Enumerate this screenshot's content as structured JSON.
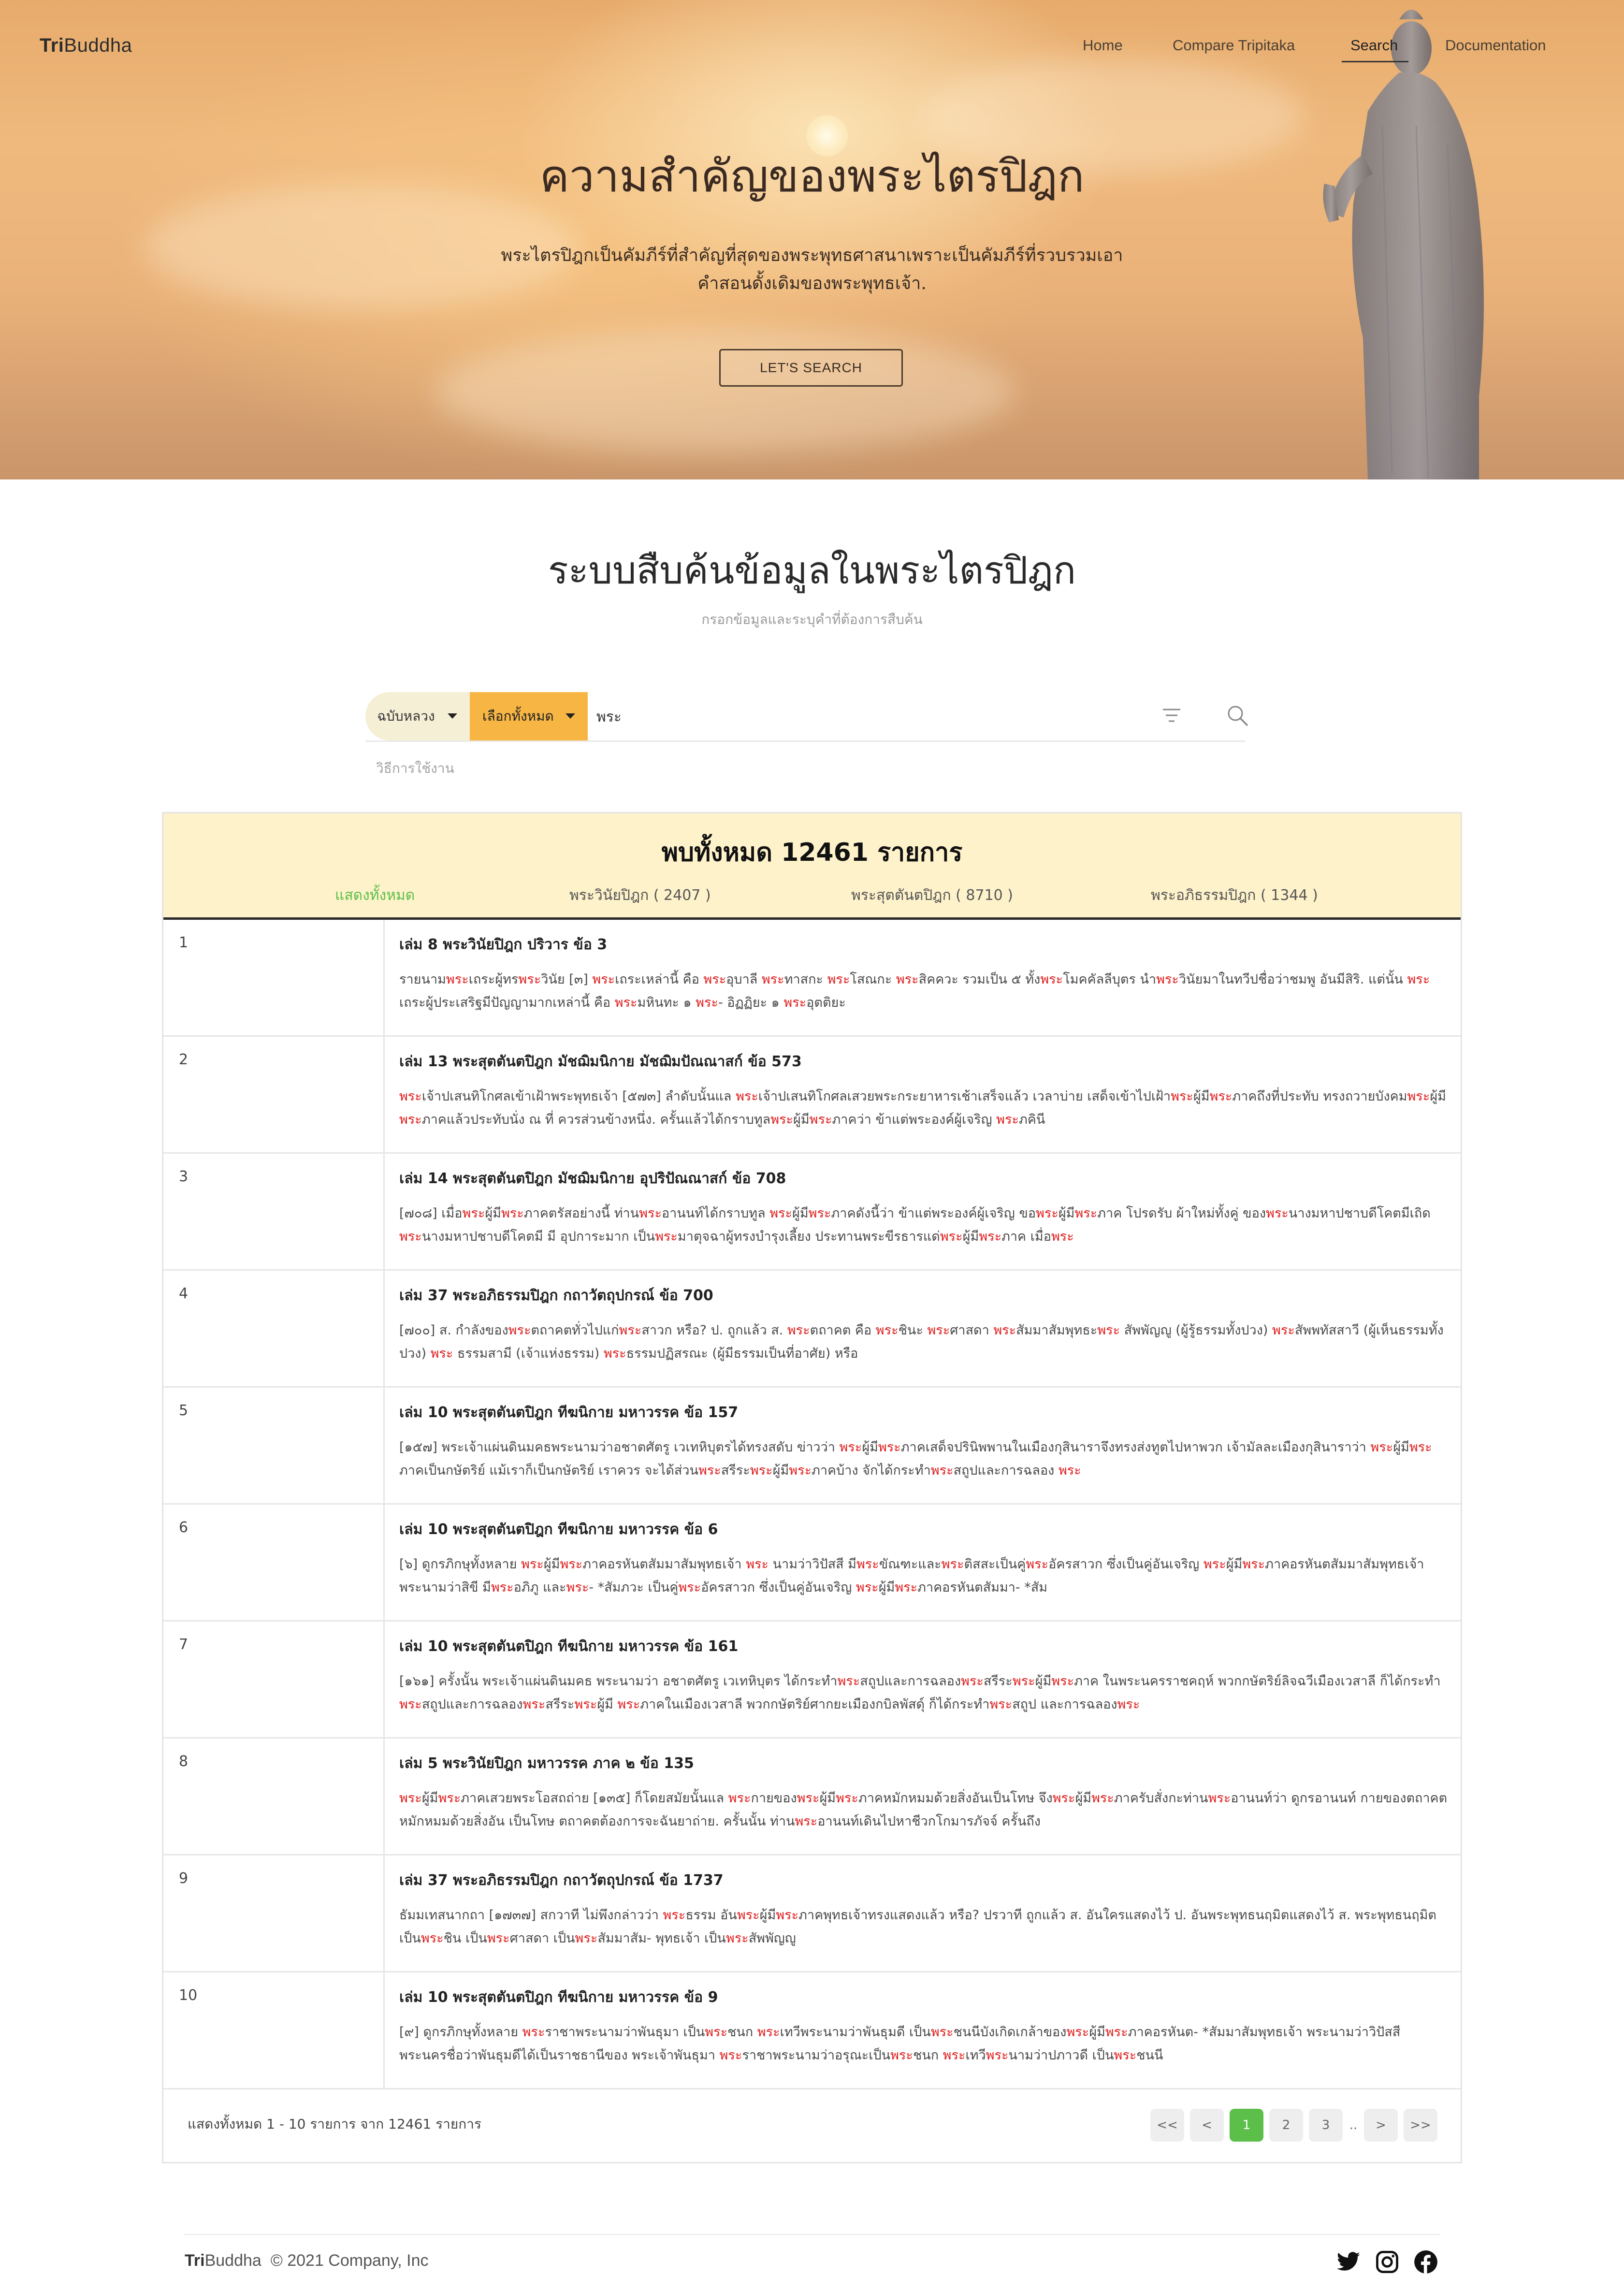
{
  "brand": {
    "bold": "Tri",
    "rest": "Buddha"
  },
  "nav": {
    "home": "Home",
    "compare": "Compare Tripitaka",
    "search": "Search",
    "documentation": "Documentation"
  },
  "hero": {
    "title": "ความสำคัญของพระไตรปิฎก",
    "description": "พระไตรปิฎกเป็นคัมภีร์ที่สำคัญที่สุดของพระพุทธศาสนาเพราะเป็นคัมภีร์ที่รวบรวมเอาคำสอนดั้งเดิมของพระพุทธเจ้า.",
    "button": "LET'S SEARCH"
  },
  "search": {
    "title": "ระบบสืบค้นข้อมูลในพระไตรปิฎก",
    "subtitle": "กรอกข้อมูลและระบุคำที่ต้องการสืบค้น",
    "edition_selected": "ฉบับหลวง",
    "book_selected": "เลือกทั้งหมด",
    "query_value": "พระ",
    "howto": "วิธีการใช้งาน"
  },
  "results": {
    "header": "พบทั้งหมด 12461 รายการ",
    "tabs": {
      "all": "แสดงทั้งหมด",
      "vinaya": "พระวินัยปิฎก ( 2407 )",
      "sutta": "พระสุตตันตปิฎก ( 8710 )",
      "abhidhamma": "พระอภิธรรมปิฎก ( 1344 )"
    },
    "highlight_color": "#e11d1d",
    "items": [
      {
        "num": "1",
        "title": "เล่ม 8 พระวินัยปิฎก ปริวาร ข้อ 3",
        "snippet": "รายนาม[[พระ]]เถระผู้ทร[[พระ]]วินัย [๓] [[พระ]]เถระเหล่านี้ คือ [[พระ]]อุบาลี [[พระ]]ทาสกะ [[พระ]]โสณกะ [[พระ]]สิคควะ รวมเป็น ๕ ทั้ง[[พระ]]โมคคัลลีบุตร นำ[[พระ]]วินัยมาในทวีปชื่อว่าชมพู อันมีสิริ. แต่นั้น [[พระ]]เถระผู้ประเสริฐมีปัญญามากเหล่านี้ คือ [[พระ]]มหินทะ ๑ [[พระ]]- อิฏฏิยะ ๑ [[พระ]]อุตติยะ"
      },
      {
        "num": "2",
        "title": "เล่ม 13 พระสุตตันตปิฎก มัชฌิมนิกาย มัชฌิมปัณณาสก์ ข้อ 573",
        "snippet": "[[พระ]]เจ้าปเสนทิโกศลเข้าเฝ้าพระพุทธเจ้า [๕๗๓] ลำดับนั้นแล [[พระ]]เจ้าปเสนทิโกศลเสวยพระกระยาหารเช้าเสร็จแล้ว เวลาบ่าย เสด็จเข้าไปเฝ้า[[พระ]]ผู้มี[[พระ]]ภาคถึงที่ประทับ ทรงถวายบังคม[[พระ]]ผู้มี[[พระ]]ภาคแล้วประทับนั่ง ณ ที่ ควรส่วนข้างหนึ่ง. ครั้นแล้วได้กราบทูล[[พระ]]ผู้มี[[พระ]]ภาคว่า ข้าแต่พระองค์ผู้เจริญ [[พระ]]ภคินี"
      },
      {
        "num": "3",
        "title": "เล่ม 14 พระสุตตันตปิฎก มัชฌิมนิกาย อุปริปัณณาสก์ ข้อ 708",
        "snippet": "[๗๐๘] เมื่อ[[พระ]]ผู้มี[[พระ]]ภาคตรัสอย่างนี้ ท่าน[[พระ]]อานนท์ได้กราบทูล [[พระ]]ผู้มี[[พระ]]ภาคดังนี้ว่า ข้าแต่พระองค์ผู้เจริญ ขอ[[พระ]]ผู้มี[[พระ]]ภาค โปรดรับ ผ้าใหม่ทั้งคู่ ของ[[พระ]]นางมหาปชาบดีโคตมีเถิด [[พระ]]นางมหาปชาบดีโคตมี มี อุปการะมาก เป็น[[พระ]]มาตุจฉาผู้ทรงบำรุงเลี้ยง ประทานพระขีรธารแด่[[พระ]]ผู้มี[[พระ]]ภาค เมื่อ[[พระ]]"
      },
      {
        "num": "4",
        "title": "เล่ม 37 พระอภิธรรมปิฎก กถาวัตถุปกรณ์ ข้อ 700",
        "snippet": "[๗๐๐] ส. กำลังของ[[พระ]]ตถาคตทั่วไปแก่[[พระ]]สาวก หรือ? ป. ถูกแล้ว ส. [[พระ]]ตถาคต คือ [[พระ]]ชินะ [[พระ]]ศาสดา [[พระ]]สัมมาสัมพุทธะ[[พระ]] สัพพัญญู (ผู้รู้ธรรมทั้งปวง) [[พระ]]สัพพทัสสาวี (ผู้เห็นธรรมทั้งปวง) [[พระ]] ธรรมสามี (เจ้าแห่งธรรม) [[พระ]]ธรรมปฏิสรณะ (ผู้มีธรรมเป็นที่อาศัย) หรือ"
      },
      {
        "num": "5",
        "title": "เล่ม 10 พระสุตตันตปิฎก ทีฆนิกาย มหาวรรค ข้อ 157",
        "snippet": "[๑๕๗] พระเจ้าแผ่นดินมคธพระนามว่าอชาตศัตรู เวเทหิบุตรได้ทรงสดับ ข่าวว่า [[พระ]]ผู้มี[[พระ]]ภาคเสด็จปรินิพพานในเมืองกุสินาราจึงทรงส่งทูตไปหาพวก เจ้ามัลละเมืองกุสินาราว่า [[พระ]]ผู้มี[[พระ]]ภาคเป็นกษัตริย์ แม้เราก็เป็นกษัตริย์ เราควร จะได้ส่วน[[พระ]]สรีระ[[พระ]]ผู้มี[[พระ]]ภาคบ้าง จักได้กระทำ[[พระ]]สถูปและการฉลอง [[พระ]]"
      },
      {
        "num": "6",
        "title": "เล่ม 10 พระสุตตันตปิฎก ทีฆนิกาย มหาวรรค ข้อ 6",
        "snippet": "[๖] ดูกรภิกษุทั้งหลาย [[พระ]]ผู้มี[[พระ]]ภาคอรหันตสัมมาสัมพุทธเจ้า [[พระ]] นามว่าวิปัสสี มี[[พระ]]ขัณฑะและ[[พระ]]ติสสะเป็นคู่[[พระ]]อัครสาวก ซึ่งเป็นคู่อันเจริญ [[พระ]]ผู้มี[[พระ]]ภาคอรหันตสัมมาสัมพุทธเจ้า พระนามว่าสิขี มี[[พระ]]อภิภู และ[[พระ]]- *สัมภวะ เป็นคู่[[พระ]]อัครสาวก ซึ่งเป็นคู่อันเจริญ [[พระ]]ผู้มี[[พระ]]ภาคอรหันตสัมมา- *สัม"
      },
      {
        "num": "7",
        "title": "เล่ม 10 พระสุตตันตปิฎก ทีฆนิกาย มหาวรรค ข้อ 161",
        "snippet": "[๑๖๑] ครั้งนั้น พระเจ้าแผ่นดินมคธ พระนามว่า อชาตศัตรู เวเทหิบุตร ได้กระทำ[[พระ]]สถูปและการฉลอง[[พระ]]สรีระ[[พระ]]ผู้มี[[พระ]]ภาค ในพระนครราชคฤห์ พวกกษัตริย์ลิจฉวีเมืองเวสาลี ก็ได้กระทำ[[พระ]]สถูปและการฉลอง[[พระ]]สรีระ[[พระ]]ผู้มี [[พระ]]ภาคในเมืองเวสาลี พวกกษัตริย์ศากยะเมืองกบิลพัสดุ์ ก็ได้กระทำ[[พระ]]สถูป และการฉลอง[[พระ]]"
      },
      {
        "num": "8",
        "title": "เล่ม 5 พระวินัยปิฎก มหาวรรค ภาค ๒ ข้อ 135",
        "snippet": "[[พระ]]ผู้มี[[พระ]]ภาคเสวยพระโอสถถ่าย [๑๓๕] ก็โดยสมัยนั้นแล [[พระ]]กายของ[[พระ]]ผู้มี[[พระ]]ภาคหมักหมมด้วยสิ่งอันเป็นโทษ จึง[[พระ]]ผู้มี[[พระ]]ภาครับสั่งกะท่าน[[พระ]]อานนท์ว่า ดูกรอานนท์ กายของตถาคตหมักหมมด้วยสิ่งอัน เป็นโทษ ตถาคตต้องการจะฉันยาถ่าย. ครั้นนั้น ท่าน[[พระ]]อานนท์เดินไปหาชีวกโกมารภัจจ์ ครั้นถึง"
      },
      {
        "num": "9",
        "title": "เล่ม 37 พระอภิธรรมปิฎก กถาวัตถุปกรณ์ ข้อ 1737",
        "snippet": "ธัมมเทสนากถา [๑๗๓๗] สกวาที ไม่พึงกล่าวว่า [[พระ]]ธรรม อัน[[พระ]]ผู้มี[[พระ]]ภาคพุทธเจ้าทรงแสดงแล้ว หรือ? ปรวาที ถูกแล้ว ส. อันใครแสดงไว้ ป. อันพระพุทธนฤมิตแสดงไว้ ส. พระพุทธนฤมิต เป็น[[พระ]]ชิน เป็น[[พระ]]ศาสดา เป็น[[พระ]]สัมมาสัม- พุทธเจ้า เป็น[[พระ]]สัพพัญญู"
      },
      {
        "num": "10",
        "title": "เล่ม 10 พระสุตตันตปิฎก ทีฆนิกาย มหาวรรค ข้อ 9",
        "snippet": "[๙] ดูกรภิกษุทั้งหลาย [[พระ]]ราชาพระนามว่าพันธุมา เป็น[[พระ]]ชนก [[พระ]]เทวีพระนามว่าพันธุมดี เป็น[[พระ]]ชนนีบังเกิดเกล้าของ[[พระ]]ผู้มี[[พระ]]ภาคอรหันต- *สัมมาสัมพุทธเจ้า พระนามว่าวิปัสสี พระนครชื่อว่าพันธุมดีได้เป็นราชธานีของ พระเจ้าพันธุมา [[พระ]]ราชาพระนามว่าอรุณะเป็น[[พระ]]ชนก [[พระ]]เทวี[[พระ]]นามว่าปภาวดี เป็น[[พระ]]ชนนี"
      }
    ],
    "footer_info": "แสดงทั้งหมด 1 - 10 รายการ จาก 12461 รายการ",
    "pager": {
      "first": "<<",
      "prev": "<",
      "pages": [
        "1",
        "2",
        "3"
      ],
      "current": "1",
      "ellipsis": "..",
      "next": ">",
      "last": ">>"
    }
  },
  "footer": {
    "brand_bold": "Tri",
    "brand_rest": "Buddha",
    "copyright": "© 2021 Company, Inc",
    "icons": [
      "twitter-icon",
      "instagram-icon",
      "facebook-icon"
    ]
  }
}
